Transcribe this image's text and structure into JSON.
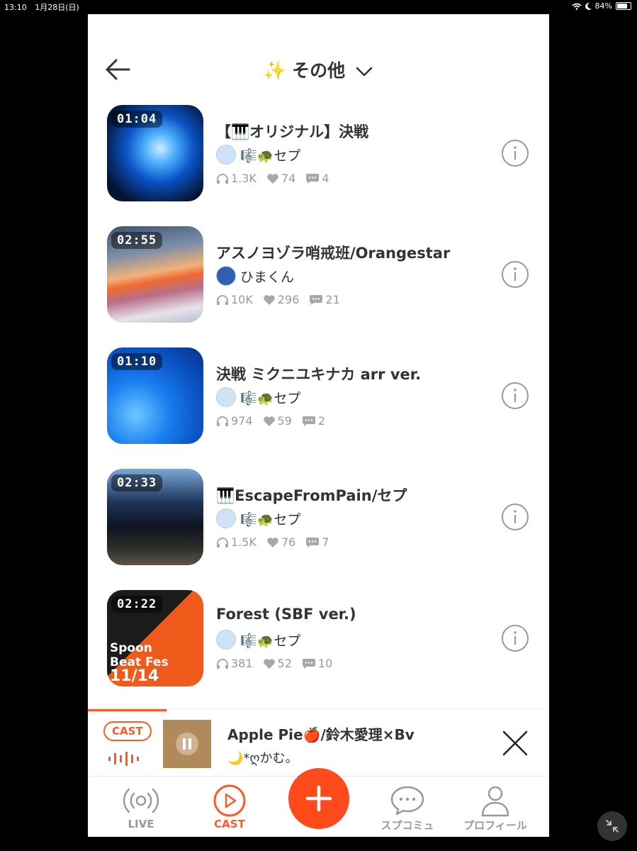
{
  "status_bar": {
    "time": "13:10",
    "date": "1月28日(日)",
    "battery": "84%"
  },
  "header": {
    "emoji": "✨",
    "title": "その他"
  },
  "items": [
    {
      "duration": "01:04",
      "title": "【🎹オリジナル】決戦",
      "author": "🎼🐢セプ",
      "plays": "1.3K",
      "likes": "74",
      "comments": "4"
    },
    {
      "duration": "02:55",
      "title": "アスノヨゾラ哨戒班/Orangestar",
      "author": "ひまくん",
      "plays": "10K",
      "likes": "296",
      "comments": "21"
    },
    {
      "duration": "01:10",
      "title": "決戦 ミクニユキナカ arr ver.",
      "author": "🎼🐢セプ",
      "plays": "974",
      "likes": "59",
      "comments": "2"
    },
    {
      "duration": "02:33",
      "title": "🎹EscapeFromPain/セプ",
      "author": "🎼🐢セプ",
      "plays": "1.5K",
      "likes": "76",
      "comments": "7"
    },
    {
      "duration": "02:22",
      "title": "Forest (SBF ver.)",
      "author": "🎼🐢セプ",
      "plays": "381",
      "likes": "52",
      "comments": "10",
      "cover_text": [
        "Spoon",
        "Beat Fes",
        "11/14"
      ]
    }
  ],
  "mini_player": {
    "badge": "CAST",
    "title": "Apple Pie🍎/鈴木愛理×Bv",
    "artist": "🌙*ღかむ。",
    "progress": 0.17
  },
  "tabs": [
    {
      "label": "LIVE",
      "icon": "broadcast-icon"
    },
    {
      "label": "CAST",
      "icon": "play-circle-icon",
      "active": true
    },
    {
      "label": "スプコミュ",
      "icon": "chat-bubble-icon"
    },
    {
      "label": "プロフィール",
      "icon": "person-icon"
    }
  ],
  "colors": {
    "accent": "#ff5a26",
    "fab": "#ff4a1c",
    "muted": "#9a9a9a"
  }
}
